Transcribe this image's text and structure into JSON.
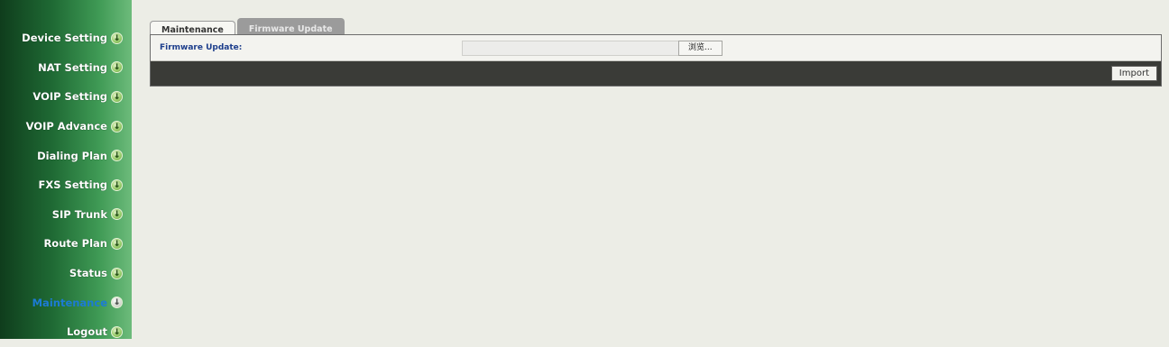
{
  "sidebar": {
    "items": [
      {
        "label": "Device Setting",
        "icon": "down-arrow-circle-icon"
      },
      {
        "label": "NAT Setting",
        "icon": "down-arrow-circle-icon"
      },
      {
        "label": "VOIP Setting",
        "icon": "down-arrow-circle-icon"
      },
      {
        "label": "VOIP Advance",
        "icon": "down-arrow-circle-icon"
      },
      {
        "label": "Dialing Plan",
        "icon": "down-arrow-circle-icon"
      },
      {
        "label": "FXS Setting",
        "icon": "down-arrow-circle-icon"
      },
      {
        "label": "SIP Trunk",
        "icon": "down-arrow-circle-icon"
      },
      {
        "label": "Route Plan",
        "icon": "down-arrow-circle-icon"
      },
      {
        "label": "Status",
        "icon": "down-arrow-circle-icon"
      },
      {
        "label": "Maintenance",
        "icon": "down-arrow-circle-icon"
      },
      {
        "label": "Logout",
        "icon": "down-arrow-circle-icon"
      }
    ],
    "active_index": 9
  },
  "tabs": [
    {
      "label": "Maintenance"
    },
    {
      "label": "Firmware Update"
    }
  ],
  "active_tab": 1,
  "form": {
    "firmware_label": "Firmware Update:",
    "file_value": "",
    "browse_label": "浏览..."
  },
  "actions": {
    "import_label": "Import"
  },
  "colors": {
    "sidebar_dark": "#0f3d1c",
    "sidebar_light": "#6dbb7b",
    "active_link": "#1c7bd4",
    "label_blue": "#1d3e8c",
    "action_bar": "#3a3b37"
  }
}
